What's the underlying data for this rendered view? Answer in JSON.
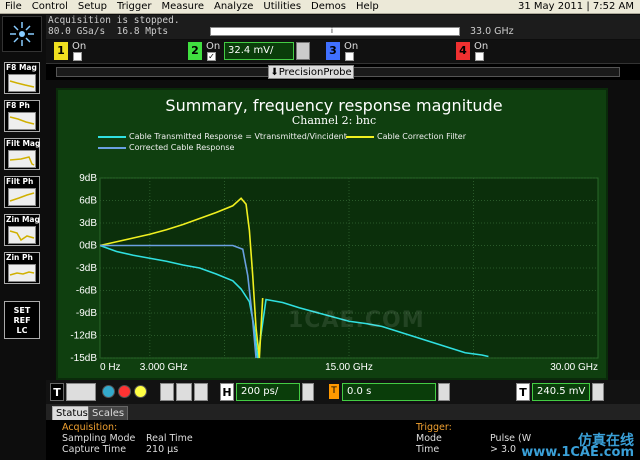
{
  "menu": [
    "File",
    "Control",
    "Setup",
    "Trigger",
    "Measure",
    "Analyze",
    "Utilities",
    "Demos",
    "Help"
  ],
  "datetime": "31 May 2011 | 7:52 AM",
  "acquisition": {
    "status": "Acquisition is stopped.",
    "rate": "80.0 GSa/s",
    "points": "16.8 Mpts",
    "bandwidth": "33.0 GHz"
  },
  "channels": {
    "ch1": {
      "num": "1",
      "label": "On",
      "color": "#f0e020",
      "checked": false
    },
    "ch2": {
      "num": "2",
      "label": "On",
      "color": "#40e040",
      "checked": true,
      "scale": "32.4 mV/"
    },
    "ch3": {
      "num": "3",
      "label": "On",
      "color": "#4070ff",
      "checked": false
    },
    "ch4": {
      "num": "4",
      "label": "On",
      "color": "#f03030",
      "checked": false
    }
  },
  "probe_tab": "PrecisionProbe",
  "functions": [
    {
      "label": "F8 Mag"
    },
    {
      "label": "F8 Ph"
    },
    {
      "label": "Filt Mag"
    },
    {
      "label": "Filt Ph"
    },
    {
      "label": "Zin Mag"
    },
    {
      "label": "Zin Ph"
    }
  ],
  "set_ref": {
    "l1": "SET",
    "l2": "REF",
    "l3": "LC"
  },
  "plot": {
    "title": "Summary, frequency response magnitude",
    "subtitle": "Channel 2: bnc",
    "watermark": "1CAE.COM",
    "legend": [
      {
        "name": "Cable Transmitted Response = Vtransmitted/Vincident",
        "color": "#30e0e0"
      },
      {
        "name": "Cable Correction Filter",
        "color": "#f0f020"
      },
      {
        "name": "Corrected Cable Response",
        "color": "#6aa0e0"
      }
    ]
  },
  "chart_data": {
    "type": "line",
    "title": "Summary, frequency response magnitude",
    "subtitle": "Channel 2: bnc",
    "xlabel": "",
    "ylabel": "",
    "x_ticks": [
      "0 Hz",
      "3.000 GHz",
      "15.00 GHz",
      "30.00 GHz"
    ],
    "y_ticks": [
      "9dB",
      "6dB",
      "3dB",
      "0dB",
      "-3dB",
      "-6dB",
      "-9dB",
      "-12dB",
      "-15dB"
    ],
    "xlim": [
      0,
      30
    ],
    "ylim": [
      -15,
      9
    ],
    "grid": true,
    "series": [
      {
        "name": "Cable Transmitted Response = Vtransmitted/Vincident",
        "color": "#30e0e0",
        "x": [
          0,
          0.5,
          1,
          2,
          3,
          4,
          5,
          6,
          7,
          8,
          8.5,
          9,
          9.3,
          9.5,
          10,
          11,
          12,
          13,
          14,
          15,
          16,
          17,
          18,
          19,
          20,
          21,
          22,
          23,
          23.4
        ],
        "y": [
          0,
          -0.4,
          -0.8,
          -1.3,
          -1.7,
          -2.1,
          -2.6,
          -3.0,
          -3.8,
          -4.7,
          -5.8,
          -7.5,
          -11,
          -15,
          -7.2,
          -7.6,
          -8.3,
          -8.9,
          -9.5,
          -10.1,
          -10.4,
          -10.8,
          -11.5,
          -12.2,
          -12.9,
          -13.6,
          -14.3,
          -14.6,
          -14.8
        ]
      },
      {
        "name": "Cable Correction Filter",
        "color": "#f0f020",
        "x": [
          0,
          1,
          2,
          3,
          4,
          5,
          6,
          7,
          8,
          8.5,
          8.8,
          9.0,
          9.2,
          9.4,
          9.6,
          9.8
        ],
        "y": [
          0,
          0.5,
          1.0,
          1.5,
          2.1,
          2.8,
          3.6,
          4.4,
          5.3,
          6.3,
          5.5,
          2.0,
          -4.0,
          -11.0,
          -15.0,
          -7.0
        ]
      },
      {
        "name": "Corrected Cable Response",
        "color": "#6aa0e0",
        "x": [
          0,
          2,
          4,
          6,
          8,
          8.6,
          8.9,
          9.2,
          9.4
        ],
        "y": [
          0,
          0,
          0,
          0,
          0,
          -0.5,
          -4,
          -10,
          -15
        ]
      }
    ]
  },
  "timebase": {
    "label": "H",
    "value": "200 ps/",
    "delay_label": "T",
    "delay": "0.0 s"
  },
  "trigger": {
    "label": "T",
    "value": "240.5 mV"
  },
  "tabs": [
    {
      "label": "Status"
    },
    {
      "label": "Scales"
    }
  ],
  "status": {
    "acq_header": "Acquisition:",
    "rows": [
      {
        "k": "Sampling Mode",
        "v": "Real Time"
      },
      {
        "k": "Capture Time",
        "v": "210 μs"
      }
    ],
    "trig_header": "Trigger:",
    "trig_rows": [
      {
        "k": "Mode",
        "v": "Pulse (W"
      },
      {
        "k": "Time",
        "v": "> 3.0"
      }
    ]
  },
  "corner_watermark": {
    "cn": "仿真在线",
    "url": "www.1CAE.com"
  }
}
